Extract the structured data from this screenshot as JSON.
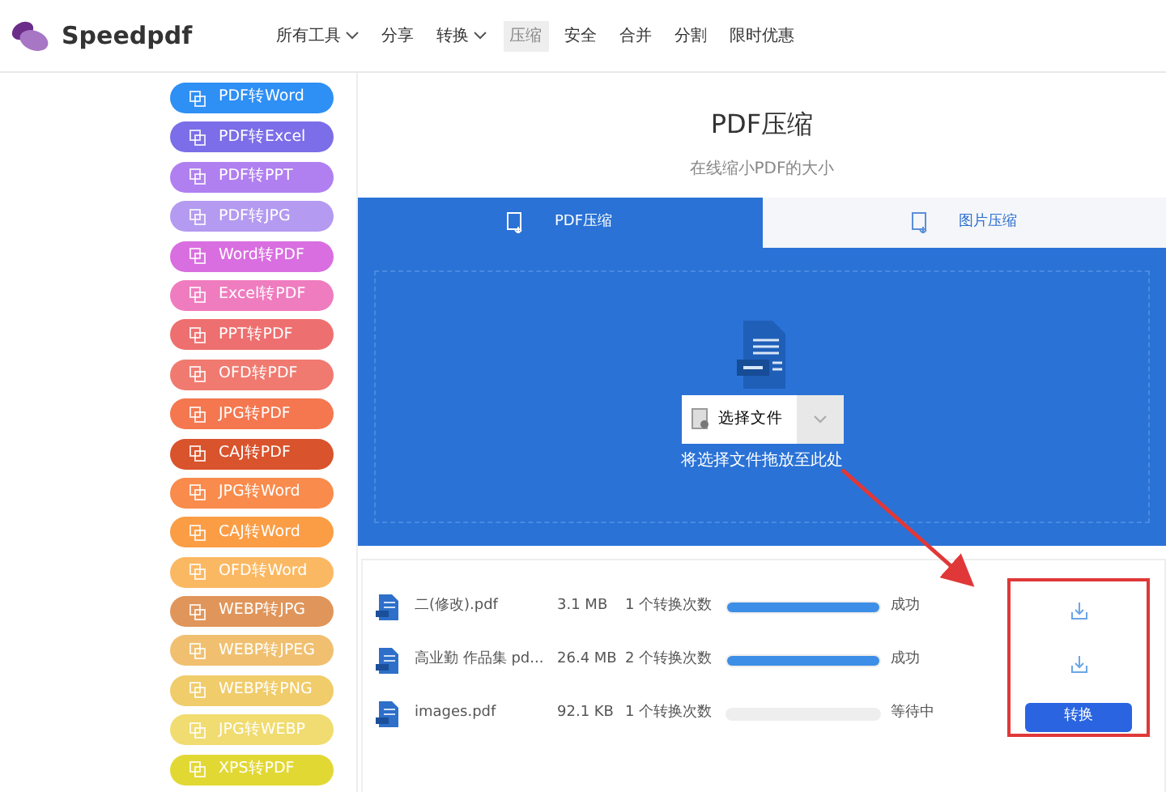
{
  "header": {
    "logo_text": "Speedpdf",
    "nav": [
      {
        "label": "所有工具",
        "dropdown": true,
        "selected": false
      },
      {
        "label": "分享",
        "dropdown": false,
        "selected": false
      },
      {
        "label": "转换",
        "dropdown": true,
        "selected": false
      },
      {
        "label": "压缩",
        "dropdown": false,
        "selected": true
      },
      {
        "label": "安全",
        "dropdown": false,
        "selected": false
      },
      {
        "label": "合并",
        "dropdown": false,
        "selected": false
      },
      {
        "label": "分割",
        "dropdown": false,
        "selected": false
      },
      {
        "label": "限时优惠",
        "dropdown": false,
        "selected": false
      }
    ]
  },
  "sidebar": {
    "items": [
      {
        "label": "PDF转Word",
        "color": "#2e8ff5"
      },
      {
        "label": "PDF转Excel",
        "color": "#7b6ee8"
      },
      {
        "label": "PDF转PPT",
        "color": "#b07ff0"
      },
      {
        "label": "PDF转JPG",
        "color": "#b49af0"
      },
      {
        "label": "Word转PDF",
        "color": "#d96ee0"
      },
      {
        "label": "Excel转PDF",
        "color": "#ef7cbf"
      },
      {
        "label": "PPT转PDF",
        "color": "#ee6f6f"
      },
      {
        "label": "OFD转PDF",
        "color": "#f07a70"
      },
      {
        "label": "JPG转PDF",
        "color": "#f4774f"
      },
      {
        "label": "CAJ转PDF",
        "color": "#d9532c"
      },
      {
        "label": "JPG转Word",
        "color": "#f98b4c"
      },
      {
        "label": "CAJ转Word",
        "color": "#fb9d45"
      },
      {
        "label": "OFD转Word",
        "color": "#fbb862"
      },
      {
        "label": "WEBP转JPG",
        "color": "#e0955a"
      },
      {
        "label": "WEBP转JPEG",
        "color": "#f0c070"
      },
      {
        "label": "WEBP转PNG",
        "color": "#f0cc6a"
      },
      {
        "label": "JPG转WEBP",
        "color": "#f0dc70"
      },
      {
        "label": "XPS转PDF",
        "color": "#e2d834"
      }
    ]
  },
  "main": {
    "title": "PDF压缩",
    "subtitle": "在线缩小PDF的大小",
    "tabs": [
      {
        "label": "PDF压缩",
        "selected": true
      },
      {
        "label": "图片压缩",
        "selected": false
      }
    ],
    "upload": {
      "button": "选择文件",
      "hint": "将选择文件拖放至此处"
    },
    "files": [
      {
        "name": "二(修改).pdf",
        "size": "3.1 MB",
        "count": "1 个转换次数",
        "level": 1,
        "status": "成功",
        "action": {
          "kind": "download"
        }
      },
      {
        "name": "高业勤 作品集 pd...",
        "size": "26.4 MB",
        "count": "2 个转换次数",
        "level": 1,
        "status": "成功",
        "action": {
          "kind": "download"
        }
      },
      {
        "name": "images.pdf",
        "size": "92.1 KB",
        "count": "1 个转换次数",
        "level": 0,
        "status": "等待中",
        "action": {
          "kind": "convert",
          "label": "转换"
        }
      }
    ]
  }
}
